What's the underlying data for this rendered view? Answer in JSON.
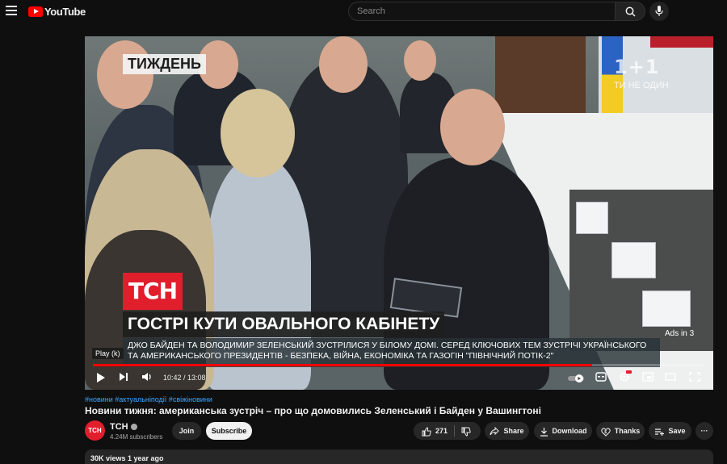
{
  "topbar": {
    "logo_text": "YouTube",
    "search_placeholder": "Search"
  },
  "player": {
    "show_label": "ТИЖДЕНЬ",
    "brand_corner": "1+1",
    "brand_sub": "ТИ НЕ ОДИН",
    "tsn_logo": "ТСН",
    "headline": "ГОСТРІ КУТИ ОВАЛЬНОГО КАБІНЕТУ",
    "subtitle": "ДЖО БАЙДЕН ТА ВОЛОДИМИР ЗЕЛЕНСЬКИЙ ЗУСТРІЛИСЯ У БІЛОМУ ДОМІ. СЕРЕД КЛЮЧОВИХ ТЕМ ЗУСТРІЧІ УКРАЇНСЬКОГО ТА АМЕРИКАНСЬКОГО ПРЕЗИДЕНТІВ - БЕЗПЕКА, ВІЙНА, ЕКОНОМІКА ТА ГАЗОГІН \"ПІВНІЧНИЙ ПОТІК-2\"",
    "ads_label": "Ads in 3",
    "play_tooltip": "Play (k)",
    "time": "10:42 / 13:08",
    "progress_fraction": 0.815
  },
  "video": {
    "tags": "#новини #актуальніподії #свіжіновини",
    "title": "Новини тижня: американська зустріч – про що домовились Зеленський і Байден у Вашингтоні"
  },
  "channel": {
    "avatar_text": "ТСН",
    "name": "ТСН",
    "subscribers": "4.24M subscribers",
    "join_label": "Join",
    "subscribe_label": "Subscribe"
  },
  "actions": {
    "likes": "271",
    "share_label": "Share",
    "download_label": "Download",
    "thanks_label": "Thanks",
    "save_label": "Save",
    "more_label": "···"
  },
  "meta": {
    "views_and_date": "30K views  1 year ago"
  },
  "colors": {
    "brand_red": "#ff0000",
    "tsn_red": "#e01e2c",
    "background": "#0f0f0f"
  }
}
